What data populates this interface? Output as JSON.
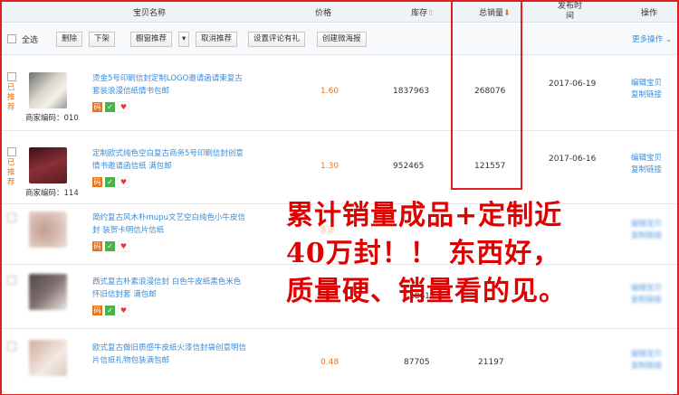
{
  "header": {
    "col_name": "宝贝名称",
    "col_price": "价格",
    "col_stock": "库存",
    "col_stock_arrow": "⇧",
    "col_sales": "总销量",
    "col_sales_arrow": "⬇",
    "col_date_1": "发布时",
    "col_date_2": "间",
    "col_ops": "操作"
  },
  "toolbar": {
    "select_all": "全选",
    "delete": "删除",
    "offshelf": "下架",
    "showcase": "橱窗推荐",
    "showcase_arrow": "▾",
    "cancel_recommend": "取消推荐",
    "set_review_gift": "设置评论有礼",
    "create_poster": "创建微海报",
    "more_ops": "更多操作 ⌄"
  },
  "rows": [
    {
      "recommended": "已推荐",
      "code_label": "商家编码：010",
      "title": "烫金5号印刷信封定制LOGO邀请函请柬复古套装浪漫信纸情书包邮",
      "price": "1.60",
      "stock": "1837963",
      "sales": "268076",
      "date": "2017-06-19",
      "op1": "编辑宝贝",
      "op2": "复制链接",
      "thumb_color": "#d9d4cf"
    },
    {
      "recommended": "已推荐",
      "code_label": "商家编码：114",
      "title": "定制欧式纯色空白复古商务5号印刷信封创意情书邀请函信纸 满包邮",
      "price": "1.30",
      "stock": "952465",
      "sales": "121557",
      "date": "2017-06-16",
      "op1": "编辑宝贝",
      "op2": "复制链接",
      "thumb_color": "#7a2a32"
    },
    {
      "recommended": "",
      "code_label": "",
      "title": "简约复古风木朴mupu文艺空白纯色小牛皮信封 装贺卡明信片信纸",
      "price": "0.2",
      "stock": "",
      "sales": "",
      "date": "",
      "op1": "编辑宝贝",
      "op2": "复制链接",
      "thumb_color": "#c9b4a8"
    },
    {
      "recommended": "",
      "code_label": "",
      "title": "西式复古朴素浪漫信封 白色牛皮纸黑色米色 怀旧信封套 满包邮",
      "price": "0.3",
      "stock": "18617",
      "sales": "",
      "date": "",
      "op1": "编辑宝贝",
      "op2": "复制链接",
      "thumb_color": "#3a2e2e"
    },
    {
      "recommended": "",
      "code_label": "",
      "title": "欧式复古做旧质感牛皮纸火漆信封袋创意明信片信纸礼物包装满包邮",
      "price": "0.48",
      "stock": "87705",
      "sales": "21197",
      "date": "",
      "op1": "编辑宝贝",
      "op2": "复制链接",
      "thumb_color": "#c7a89a"
    }
  ],
  "icons": [
    "码",
    "✓",
    "♥"
  ],
  "promo": {
    "line1": "累计销量成品+定制近",
    "line2": "40万封！！ 东西好，",
    "line3": "质量硬、销量看的见。"
  },
  "colors": {
    "accent_red": "#e02020",
    "link_blue": "#3a8bd8",
    "price_orange": "#e8731a"
  }
}
